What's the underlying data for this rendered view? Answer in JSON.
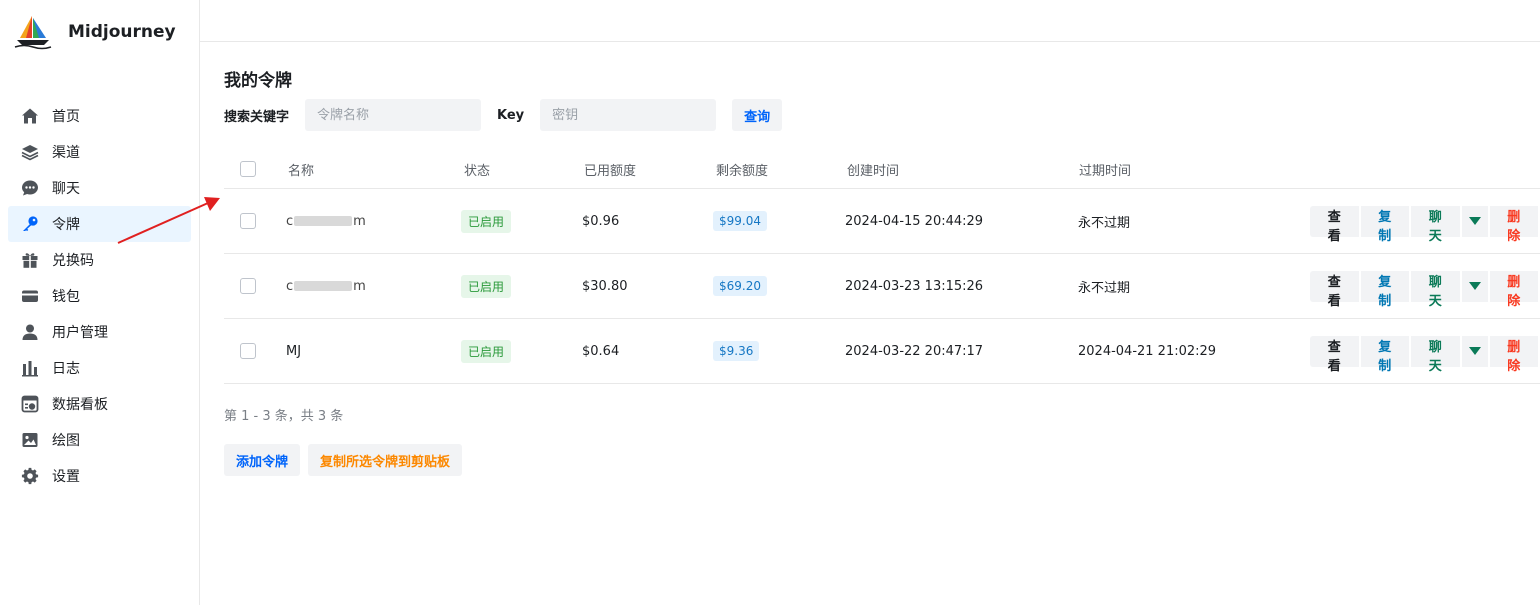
{
  "brand": {
    "name": "Midjourney"
  },
  "nav": [
    {
      "label": "首页",
      "icon": "home-icon"
    },
    {
      "label": "渠道",
      "icon": "layers-icon"
    },
    {
      "label": "聊天",
      "icon": "chat-icon"
    },
    {
      "label": "令牌",
      "icon": "key-icon",
      "active": true
    },
    {
      "label": "兑换码",
      "icon": "gift-icon"
    },
    {
      "label": "钱包",
      "icon": "wallet-icon"
    },
    {
      "label": "用户管理",
      "icon": "user-icon"
    },
    {
      "label": "日志",
      "icon": "bar-chart-icon"
    },
    {
      "label": "数据看板",
      "icon": "dashboard-icon"
    },
    {
      "label": "绘图",
      "icon": "image-icon"
    },
    {
      "label": "设置",
      "icon": "gear-icon"
    }
  ],
  "page": {
    "title": "我的令牌"
  },
  "search": {
    "keyword_label": "搜索关键字",
    "name_placeholder": "令牌名称",
    "key_label": "Key",
    "key_placeholder": "密钥",
    "query_button": "查询"
  },
  "table": {
    "headers": {
      "name": "名称",
      "status": "状态",
      "used": "已用额度",
      "remaining": "剩余额度",
      "created": "创建时间",
      "expires": "过期时间"
    },
    "rows": [
      {
        "name_prefix": "c",
        "name_suffix": "m",
        "status": "已启用",
        "used": "$0.96",
        "remaining": "$99.04",
        "created": "2024-04-15 20:44:29",
        "expires": "永不过期"
      },
      {
        "name_prefix": "c",
        "name_suffix": "m",
        "status": "已启用",
        "used": "$30.80",
        "remaining": "$69.20",
        "created": "2024-03-23 13:15:26",
        "expires": "永不过期"
      },
      {
        "name": "MJ",
        "status": "已启用",
        "used": "$0.64",
        "remaining": "$9.36",
        "created": "2024-03-22 20:47:17",
        "expires": "2024-04-21 21:02:29"
      }
    ],
    "actions": {
      "view": "查看",
      "copy": "复制",
      "chat": "聊天",
      "delete": "删除"
    }
  },
  "pagination": {
    "text": "第 1 - 3 条，共 3 条"
  },
  "buttons": {
    "add": "添加令牌",
    "copy_selected": "复制所选令牌到剪贴板"
  },
  "colors": {
    "accent": "#0064fa",
    "active_nav_bg": "#eaf5ff",
    "status_green": "#2b9a3a",
    "delete_red": "#f93920",
    "annotation_arrow": "#e02020"
  }
}
